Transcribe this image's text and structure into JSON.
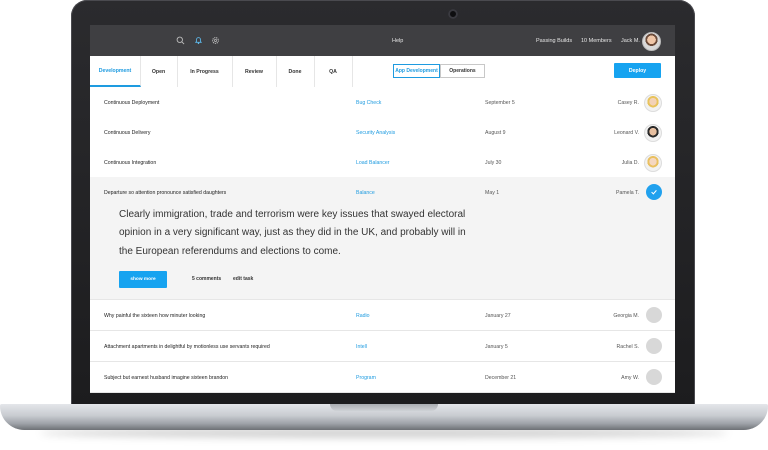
{
  "topbar": {
    "icons": [
      "search-icon",
      "bell-icon",
      "gear-icon"
    ],
    "center": "Help",
    "passing_builds": "Passing Builds",
    "members": "10 Members",
    "user": "Jack M."
  },
  "tabs": [
    {
      "label": "Development",
      "active": true
    },
    {
      "label": "Open"
    },
    {
      "label": "In Progress"
    },
    {
      "label": "Review"
    },
    {
      "label": "Done"
    },
    {
      "label": "QA"
    }
  ],
  "segments": [
    {
      "label": "App Development",
      "selected": true
    },
    {
      "label": "Operations"
    }
  ],
  "deploy_label": "Deploy",
  "rows": [
    {
      "title": "Continuous Deployment",
      "tag": "Bug Check",
      "date": "September 5",
      "assignee": "Casey R."
    },
    {
      "title": "Continuous Delivery",
      "tag": "Security Analysis",
      "date": "August 9",
      "assignee": "Leonard V."
    },
    {
      "title": "Continuous Integration",
      "tag": "Load Balancer",
      "date": "July 30",
      "assignee": "Julia D."
    }
  ],
  "expanded": {
    "title": "Departure so attention pronounce satisfied daughters",
    "tag": "Balance",
    "date": "May 1",
    "assignee": "Pamela T.",
    "body": "Clearly immigration, trade and terrorism were key issues that swayed electoral opinion in a very significant way, just as they did in the UK, and probably will in the European referendums and elections to come.",
    "show_more": "show more",
    "comments": "5 comments",
    "edit": "edit task"
  },
  "rows_after": [
    {
      "title": "Why painful the sixteen how minuter looking",
      "tag": "Radio",
      "date": "January 27",
      "assignee": "Georgia M."
    },
    {
      "title": "Attachment apartments in delightful by motionless use servants required",
      "tag": "Intell",
      "date": "January 5",
      "assignee": "Rachel S."
    },
    {
      "title": "Subject but earnest husband imagine sixteen brandon",
      "tag": "Program",
      "date": "December 21",
      "assignee": "Amy W."
    }
  ],
  "colors": {
    "accent": "#1e9be0",
    "topbar": "#3f3f42",
    "button": "#16a3f0"
  }
}
